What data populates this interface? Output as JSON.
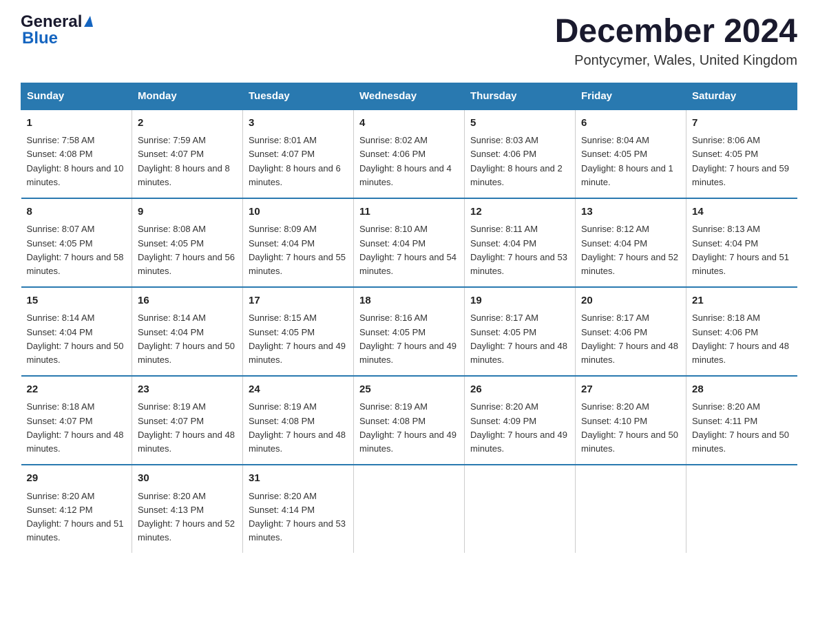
{
  "header": {
    "logo_general": "General",
    "logo_blue": "Blue",
    "title": "December 2024",
    "subtitle": "Pontycymer, Wales, United Kingdom"
  },
  "calendar": {
    "days_of_week": [
      "Sunday",
      "Monday",
      "Tuesday",
      "Wednesday",
      "Thursday",
      "Friday",
      "Saturday"
    ],
    "weeks": [
      [
        {
          "day": "1",
          "sunrise": "7:58 AM",
          "sunset": "4:08 PM",
          "daylight": "8 hours and 10 minutes."
        },
        {
          "day": "2",
          "sunrise": "7:59 AM",
          "sunset": "4:07 PM",
          "daylight": "8 hours and 8 minutes."
        },
        {
          "day": "3",
          "sunrise": "8:01 AM",
          "sunset": "4:07 PM",
          "daylight": "8 hours and 6 minutes."
        },
        {
          "day": "4",
          "sunrise": "8:02 AM",
          "sunset": "4:06 PM",
          "daylight": "8 hours and 4 minutes."
        },
        {
          "day": "5",
          "sunrise": "8:03 AM",
          "sunset": "4:06 PM",
          "daylight": "8 hours and 2 minutes."
        },
        {
          "day": "6",
          "sunrise": "8:04 AM",
          "sunset": "4:05 PM",
          "daylight": "8 hours and 1 minute."
        },
        {
          "day": "7",
          "sunrise": "8:06 AM",
          "sunset": "4:05 PM",
          "daylight": "7 hours and 59 minutes."
        }
      ],
      [
        {
          "day": "8",
          "sunrise": "8:07 AM",
          "sunset": "4:05 PM",
          "daylight": "7 hours and 58 minutes."
        },
        {
          "day": "9",
          "sunrise": "8:08 AM",
          "sunset": "4:05 PM",
          "daylight": "7 hours and 56 minutes."
        },
        {
          "day": "10",
          "sunrise": "8:09 AM",
          "sunset": "4:04 PM",
          "daylight": "7 hours and 55 minutes."
        },
        {
          "day": "11",
          "sunrise": "8:10 AM",
          "sunset": "4:04 PM",
          "daylight": "7 hours and 54 minutes."
        },
        {
          "day": "12",
          "sunrise": "8:11 AM",
          "sunset": "4:04 PM",
          "daylight": "7 hours and 53 minutes."
        },
        {
          "day": "13",
          "sunrise": "8:12 AM",
          "sunset": "4:04 PM",
          "daylight": "7 hours and 52 minutes."
        },
        {
          "day": "14",
          "sunrise": "8:13 AM",
          "sunset": "4:04 PM",
          "daylight": "7 hours and 51 minutes."
        }
      ],
      [
        {
          "day": "15",
          "sunrise": "8:14 AM",
          "sunset": "4:04 PM",
          "daylight": "7 hours and 50 minutes."
        },
        {
          "day": "16",
          "sunrise": "8:14 AM",
          "sunset": "4:04 PM",
          "daylight": "7 hours and 50 minutes."
        },
        {
          "day": "17",
          "sunrise": "8:15 AM",
          "sunset": "4:05 PM",
          "daylight": "7 hours and 49 minutes."
        },
        {
          "day": "18",
          "sunrise": "8:16 AM",
          "sunset": "4:05 PM",
          "daylight": "7 hours and 49 minutes."
        },
        {
          "day": "19",
          "sunrise": "8:17 AM",
          "sunset": "4:05 PM",
          "daylight": "7 hours and 48 minutes."
        },
        {
          "day": "20",
          "sunrise": "8:17 AM",
          "sunset": "4:06 PM",
          "daylight": "7 hours and 48 minutes."
        },
        {
          "day": "21",
          "sunrise": "8:18 AM",
          "sunset": "4:06 PM",
          "daylight": "7 hours and 48 minutes."
        }
      ],
      [
        {
          "day": "22",
          "sunrise": "8:18 AM",
          "sunset": "4:07 PM",
          "daylight": "7 hours and 48 minutes."
        },
        {
          "day": "23",
          "sunrise": "8:19 AM",
          "sunset": "4:07 PM",
          "daylight": "7 hours and 48 minutes."
        },
        {
          "day": "24",
          "sunrise": "8:19 AM",
          "sunset": "4:08 PM",
          "daylight": "7 hours and 48 minutes."
        },
        {
          "day": "25",
          "sunrise": "8:19 AM",
          "sunset": "4:08 PM",
          "daylight": "7 hours and 49 minutes."
        },
        {
          "day": "26",
          "sunrise": "8:20 AM",
          "sunset": "4:09 PM",
          "daylight": "7 hours and 49 minutes."
        },
        {
          "day": "27",
          "sunrise": "8:20 AM",
          "sunset": "4:10 PM",
          "daylight": "7 hours and 50 minutes."
        },
        {
          "day": "28",
          "sunrise": "8:20 AM",
          "sunset": "4:11 PM",
          "daylight": "7 hours and 50 minutes."
        }
      ],
      [
        {
          "day": "29",
          "sunrise": "8:20 AM",
          "sunset": "4:12 PM",
          "daylight": "7 hours and 51 minutes."
        },
        {
          "day": "30",
          "sunrise": "8:20 AM",
          "sunset": "4:13 PM",
          "daylight": "7 hours and 52 minutes."
        },
        {
          "day": "31",
          "sunrise": "8:20 AM",
          "sunset": "4:14 PM",
          "daylight": "7 hours and 53 minutes."
        },
        null,
        null,
        null,
        null
      ]
    ],
    "labels": {
      "sunrise": "Sunrise:",
      "sunset": "Sunset:",
      "daylight": "Daylight:"
    }
  }
}
